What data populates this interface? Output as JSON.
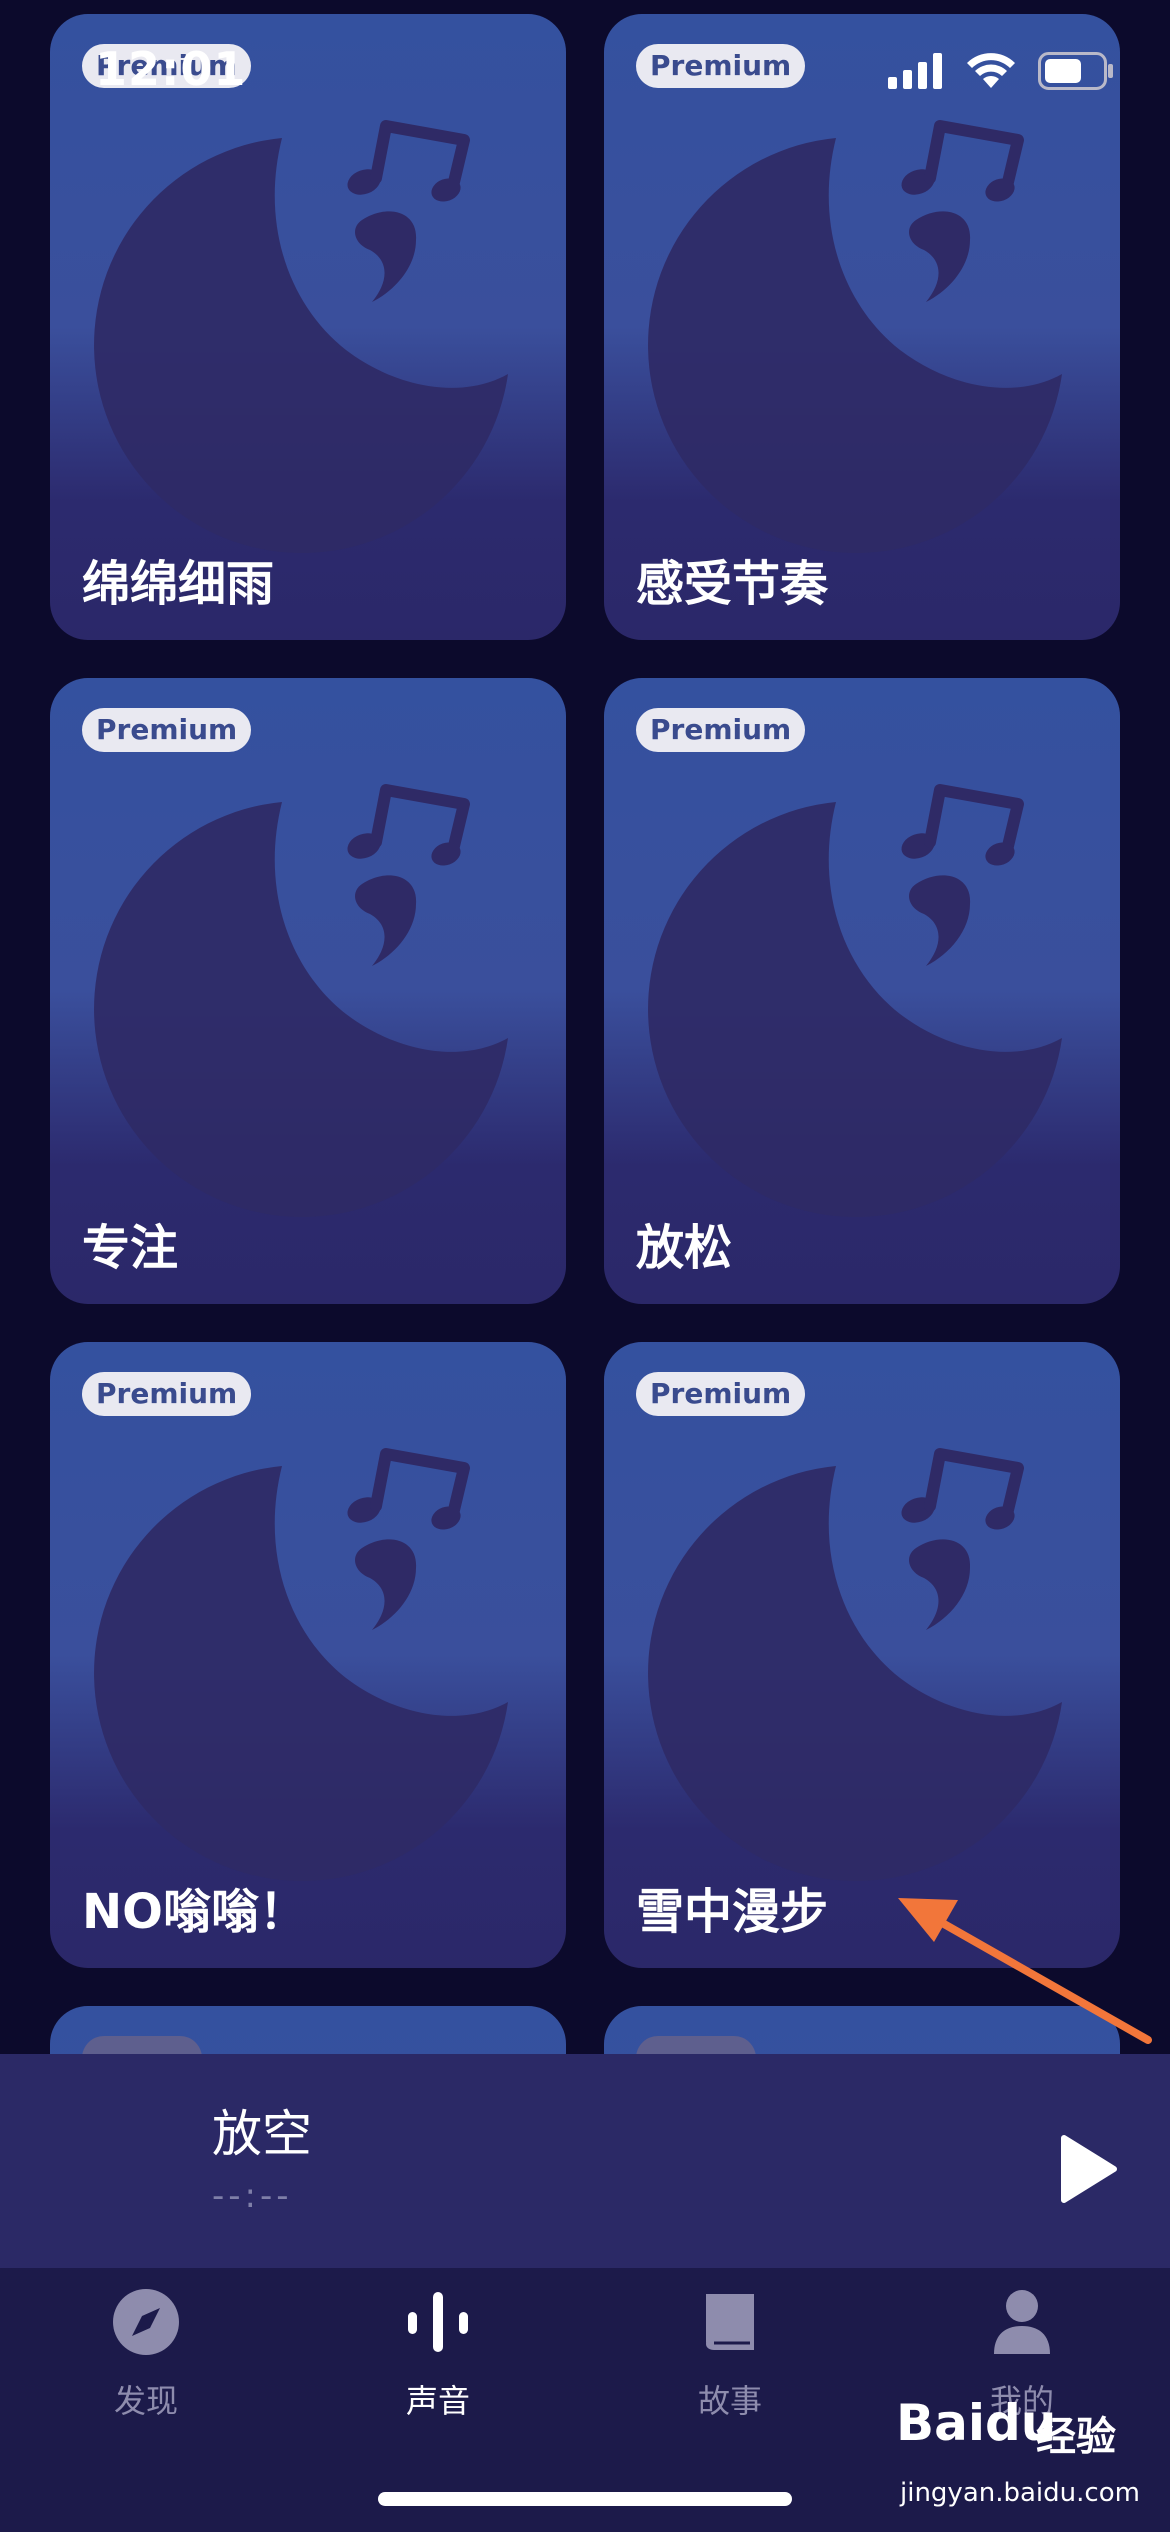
{
  "status_bar": {
    "time": "12:01"
  },
  "cards": [
    {
      "badge": "Premium",
      "title": "绵绵细雨"
    },
    {
      "badge": "Premium",
      "title": "感受节奏"
    },
    {
      "badge": "Premium",
      "title": "专注"
    },
    {
      "badge": "Premium",
      "title": "放松"
    },
    {
      "badge": "Premium",
      "title": "NO嗡嗡！"
    },
    {
      "badge": "Premium",
      "title": "雪中漫步"
    },
    {
      "badge": "",
      "title": ""
    },
    {
      "badge": "",
      "title": ""
    }
  ],
  "now_playing": {
    "title": "放空",
    "time": "--:--"
  },
  "tabs": [
    {
      "label": "发现",
      "icon": "compass-icon"
    },
    {
      "label": "声音",
      "icon": "sound-wave-icon"
    },
    {
      "label": "故事",
      "icon": "book-icon"
    },
    {
      "label": "我的",
      "icon": "person-icon"
    }
  ],
  "watermark": {
    "brand": "Baidu",
    "brand_cn": "经验",
    "url": "jingyan.baidu.com"
  },
  "colors": {
    "accent_arrow": "#f2763a",
    "card_top": "#34519f",
    "card_bottom": "#2b2869",
    "background": "#0c0a2c"
  }
}
